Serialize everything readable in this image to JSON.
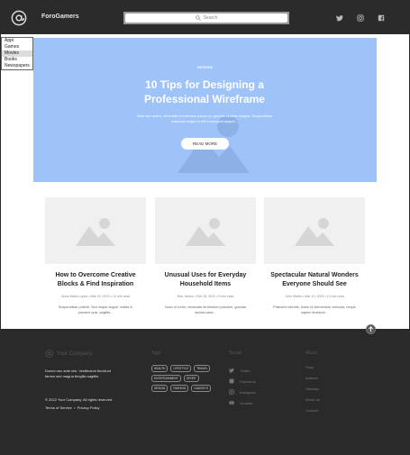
{
  "header": {
    "brand": "ForoGamers",
    "search_placeholder": "Search",
    "social_icons": [
      "twitter-icon",
      "instagram-icon",
      "facebook-icon"
    ]
  },
  "dropdown": {
    "options": [
      "Appi",
      "Games",
      "Movies",
      "Books",
      "Newspapers"
    ],
    "selected": "Movies"
  },
  "hero": {
    "category": "DESIGN",
    "title": "10 Tips for Designing a Professional Wireframe",
    "text": "Nam sed lorem, venenatis fermentum ipsum id, gravida facilisis magna. Suspendisse euismod neque et elit consequat aliquet...",
    "button": "READ MORE"
  },
  "cards": [
    {
      "title": "How to Overcome Creative Blocks & Find Inspiration",
      "meta": "Anna Maria Lopez  •  Mar 15, 2022  •  10 min read",
      "excerpt": "Suspendisse potenti. Sed neque augue, mattis in posuere quis, sagittis..."
    },
    {
      "title": "Unusual Uses for Everyday Household Items",
      "meta": "Bob James  •  Feb 28, 2022  •  9 min read",
      "excerpt": "Nunc ut tortor, venenatis fermentum posuere, gravida lacinia carta..."
    },
    {
      "title": "Spectacular Natural Wonders Everyone Should See",
      "meta": "John Martin  •  Mar 10, 2022  •  10 min read",
      "excerpt": "Praesent lobortis, lorem id elementum vehicula, neque sapien tincidunt..."
    }
  ],
  "footer": {
    "company": "Your Company",
    "description": "Donec nec ante nisi. Vestibulum tincidunt fames sed magna fringilla sagittis.",
    "copyright": "© 2022 Your Company. All rights reserved.",
    "terms": "Terms of Service",
    "privacy": "Privacy Policy",
    "tags_heading": "Tags",
    "tags": [
      "HEALTH",
      "LIFESTYLE",
      "TRAVEL",
      "ENTERTAINMENT",
      "SPORT",
      "DESIGN",
      "FASHION",
      "GADGETS"
    ],
    "social_heading": "Social",
    "social": [
      "Twitter",
      "Facebook",
      "Instagram",
      "Youtube"
    ],
    "about_heading": "About",
    "about": [
      "Shop",
      "Authors",
      "Sitemap",
      "About us",
      "Contact"
    ]
  }
}
